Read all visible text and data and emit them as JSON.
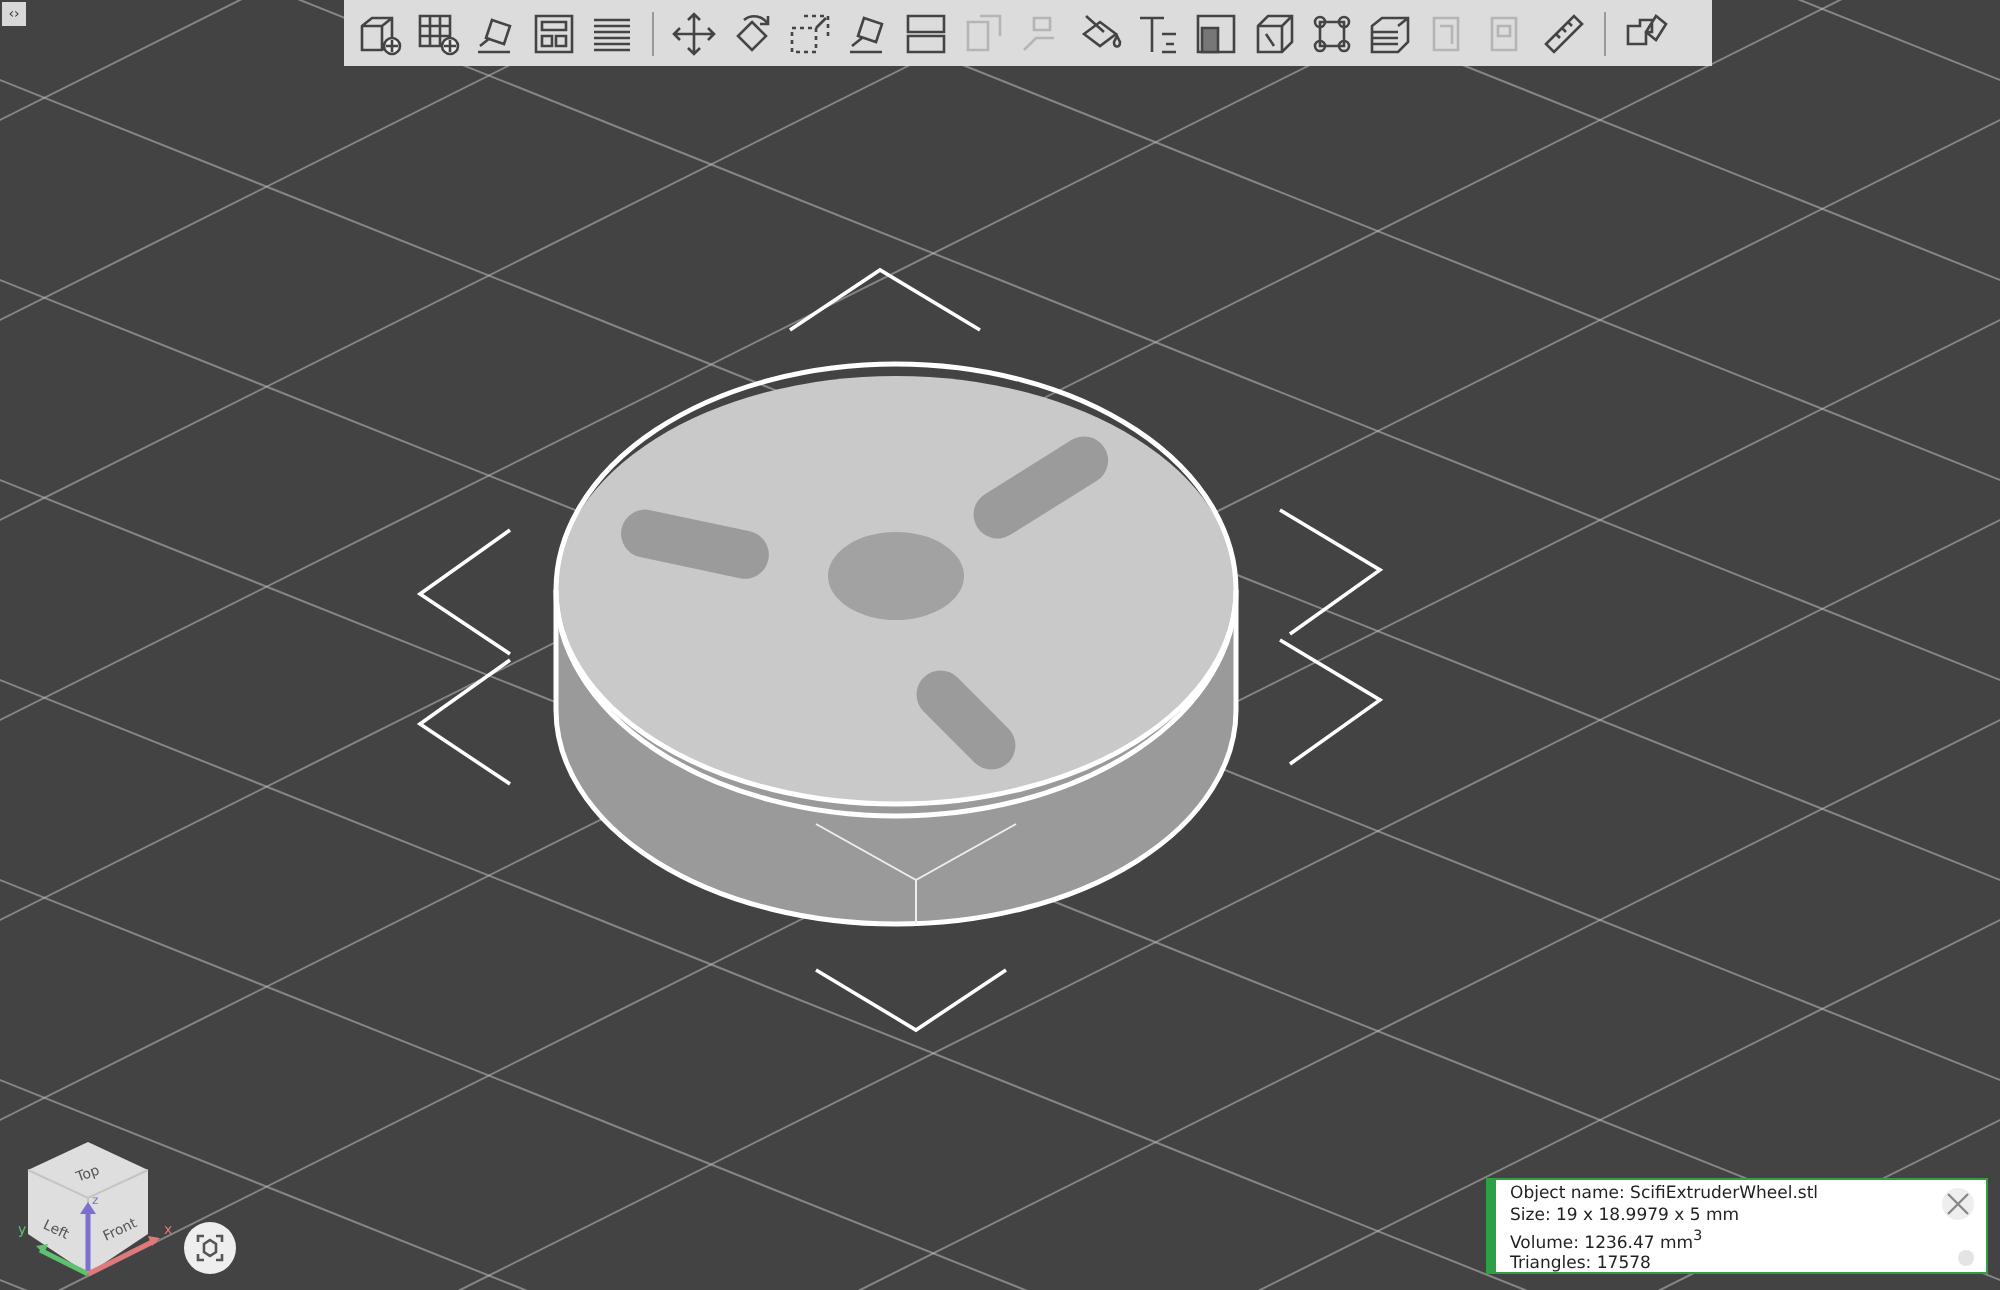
{
  "panel_toggle": {
    "label": "‹›"
  },
  "toolbar": {
    "items": [
      {
        "kind": "button",
        "disabled": false
      },
      {
        "kind": "button",
        "disabled": false
      },
      {
        "kind": "button",
        "disabled": false
      },
      {
        "kind": "button",
        "disabled": false
      },
      {
        "kind": "button",
        "disabled": false
      },
      {
        "kind": "separator"
      },
      {
        "kind": "button",
        "disabled": false
      },
      {
        "kind": "button",
        "disabled": false
      },
      {
        "kind": "button",
        "disabled": false
      },
      {
        "kind": "button",
        "disabled": false
      },
      {
        "kind": "button",
        "disabled": false
      },
      {
        "kind": "button",
        "disabled": true
      },
      {
        "kind": "button",
        "disabled": true
      },
      {
        "kind": "button",
        "disabled": false
      },
      {
        "kind": "button",
        "disabled": false
      },
      {
        "kind": "button",
        "disabled": false
      },
      {
        "kind": "button",
        "disabled": false
      },
      {
        "kind": "button",
        "disabled": false
      },
      {
        "kind": "button",
        "disabled": false
      },
      {
        "kind": "button",
        "disabled": true
      },
      {
        "kind": "button",
        "disabled": true
      },
      {
        "kind": "button",
        "disabled": false
      },
      {
        "kind": "separator"
      },
      {
        "kind": "button",
        "disabled": false
      }
    ]
  },
  "view_cube": {
    "faces": [
      "Top",
      "Left",
      "Front"
    ],
    "axes": [
      "x",
      "y",
      "z"
    ]
  },
  "object_info": {
    "lines": [
      "Object name: ScifiExtruderWheel.stl",
      "Size: 19 x 18.9979 x 5 mm",
      "Volume: 1236.47 mm$^{3}$",
      "Triangles: 17578"
    ]
  }
}
